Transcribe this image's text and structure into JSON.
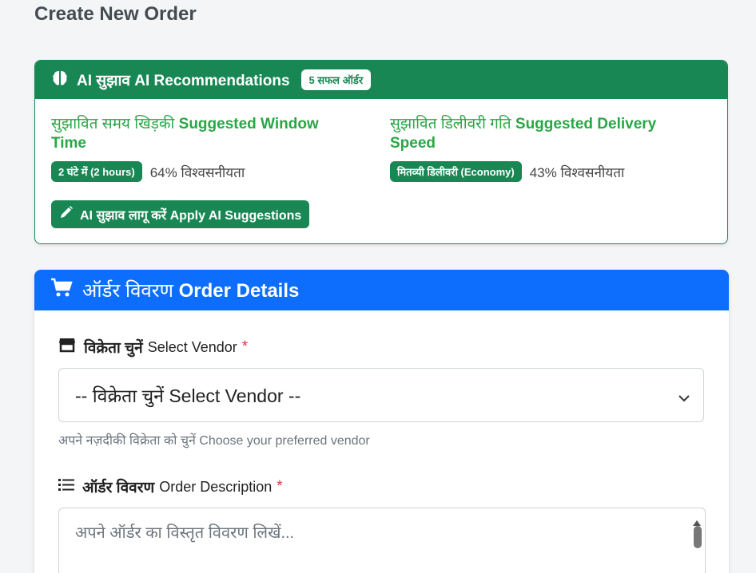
{
  "page": {
    "title": "Create New Order"
  },
  "ai": {
    "title": "AI सुझाव AI Recommendations",
    "badge": "5 सफल ऑर्डर",
    "window": {
      "title_hi": "सुझावित समय खिड़की",
      "title_en": "Suggested Window Time",
      "value": "2 घंटे में (2 hours)",
      "confidence": "64% विश्वसनीयता"
    },
    "speed": {
      "title_hi": "सुझावित डिलीवरी गति",
      "title_en": "Suggested Delivery Speed",
      "value": "मितव्यी डिलीवरी (Economy)",
      "confidence": "43% विश्वसनीयता"
    },
    "apply_label": "AI सुझाव लागू करें Apply AI Suggestions"
  },
  "order": {
    "title_hi": "ऑर्डर विवरण",
    "title_en": "Order Details",
    "vendor": {
      "label_hi": "विक्रेता चुनें",
      "label_en": "Select Vendor",
      "required": "*",
      "selected": "-- विक्रेता चुनें Select Vendor --",
      "help": "अपने नज़दीकी विक्रेता को चुनें Choose your preferred vendor"
    },
    "description": {
      "label_hi": "ऑर्डर विवरण",
      "label_en": "Order Description",
      "required": "*",
      "placeholder": "अपने ऑर्डर का विस्तृत विवरण लिखें..."
    }
  },
  "colors": {
    "success": "#198754",
    "primary": "#0d6efd",
    "danger": "#dc3545"
  },
  "icons": [
    "brain-icon",
    "pencil-icon",
    "cart-icon",
    "store-icon",
    "list-icon",
    "chevron-down-icon"
  ]
}
